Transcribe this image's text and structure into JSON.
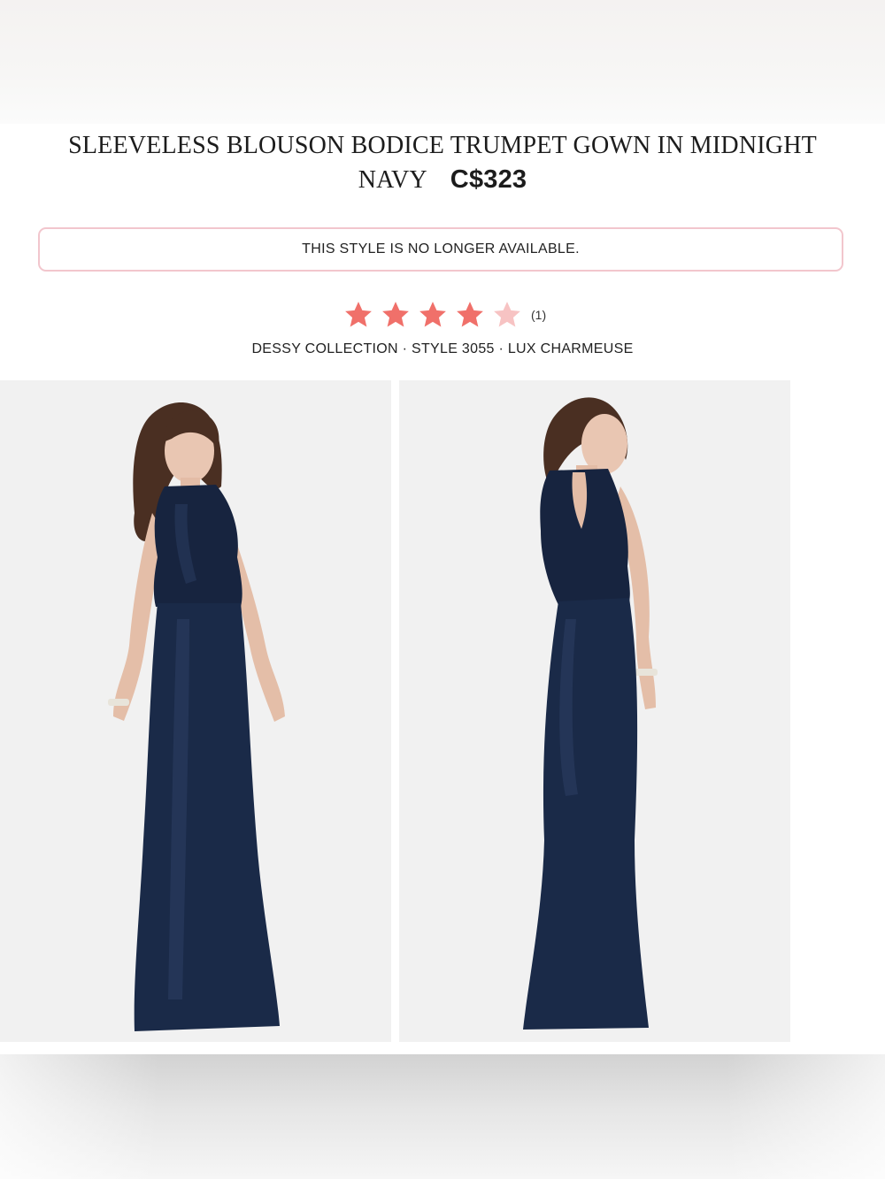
{
  "product": {
    "title": "SLEEVELESS BLOUSON BODICE TRUMPET GOWN IN MIDNIGHT NAVY",
    "price": "C$323"
  },
  "availability_notice": "THIS STYLE IS NO LONGER AVAILABLE.",
  "rating": {
    "stars": 4,
    "max_stars": 5,
    "review_count": "(1)"
  },
  "details": "DESSY COLLECTION · STYLE 3055 · LUX CHARMEUSE",
  "images": [
    {
      "name": "front-view"
    },
    {
      "name": "back-view"
    }
  ],
  "colors": {
    "star_filled": "#f0706a",
    "star_empty": "#f7c3c3",
    "notice_border": "#f2c6cd",
    "gown": "#17243f"
  }
}
